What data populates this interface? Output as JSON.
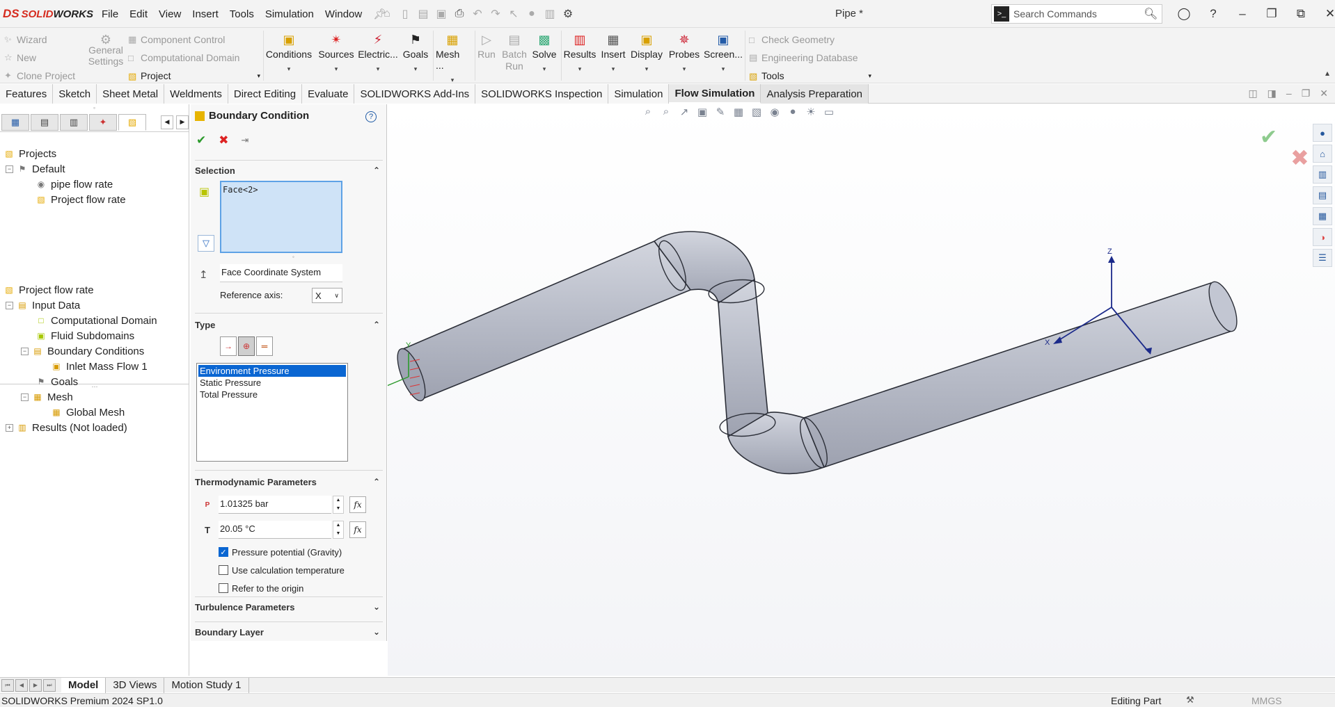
{
  "app": {
    "brand_mark": "DS",
    "brand_solid": "SOLID",
    "brand_works": "WORKS",
    "doc_title": "Pipe *"
  },
  "menu": [
    "File",
    "Edit",
    "View",
    "Insert",
    "Tools",
    "Simulation",
    "Window"
  ],
  "search": {
    "placeholder": "Search Commands"
  },
  "ribbon": {
    "left_col1": [
      "Wizard",
      "New",
      "Clone Project"
    ],
    "general_settings": "General Settings",
    "left_col2": [
      "Component Control",
      "Computational Domain",
      "Project"
    ],
    "big": [
      "Conditions",
      "Sources",
      "Electric...",
      "Goals",
      "Mesh ...",
      "Run",
      "Batch Run",
      "Solve",
      "Results",
      "Insert",
      "Display",
      "Probes",
      "Screen..."
    ],
    "right_col": [
      "Check Geometry",
      "Engineering Database",
      "Tools"
    ]
  },
  "cm_tabs": [
    "Features",
    "Sketch",
    "Sheet Metal",
    "Weldments",
    "Direct Editing",
    "Evaluate",
    "SOLIDWORKS Add-Ins",
    "SOLIDWORKS Inspection",
    "Simulation",
    "Flow Simulation",
    "Analysis Preparation"
  ],
  "tree_top": {
    "projects": "Projects",
    "default": "Default",
    "items": [
      "pipe flow rate",
      "Project flow rate"
    ]
  },
  "tree_bottom": {
    "root": "Project flow rate",
    "input_data": "Input Data",
    "computational_domain": "Computational Domain",
    "fluid_subdomains": "Fluid Subdomains",
    "boundary_conditions": "Boundary Conditions",
    "inlet_mass_flow": "Inlet Mass Flow 1",
    "goals": "Goals",
    "mesh": "Mesh",
    "global_mesh": "Global Mesh",
    "results": "Results (Not loaded)"
  },
  "property_manager": {
    "title": "Boundary Condition",
    "selection_header": "Selection",
    "selection_value": "Face<2>",
    "coord_system": "Face Coordinate System",
    "ref_axis_label": "Reference axis:",
    "ref_axis_value": "X",
    "type_header": "Type",
    "type_options": [
      "Environment Pressure",
      "Static Pressure",
      "Total Pressure"
    ],
    "thermo_header": "Thermodynamic Parameters",
    "pressure_value": "1.01325 bar",
    "temp_label": "T",
    "temp_value": "20.05 °C",
    "chk_gravity": "Pressure potential (Gravity)",
    "chk_gravity_on": true,
    "chk_calc_temp": "Use calculation temperature",
    "chk_origin": "Refer to the origin",
    "turbulence_header": "Turbulence Parameters",
    "boundary_layer_header": "Boundary Layer"
  },
  "triad": {
    "x": "X",
    "y": "Y",
    "z": "Z"
  },
  "bottom_tabs": [
    "Model",
    "3D Views",
    "Motion Study 1"
  ],
  "status": {
    "left": "SOLIDWORKS Premium 2024 SP1.0",
    "mode": "Editing Part",
    "units": "MMGS"
  },
  "colors": {
    "selection_blue": "#0a66d2",
    "brand_red": "#d52b1e",
    "pipe_fill": "#b9bdc8"
  }
}
